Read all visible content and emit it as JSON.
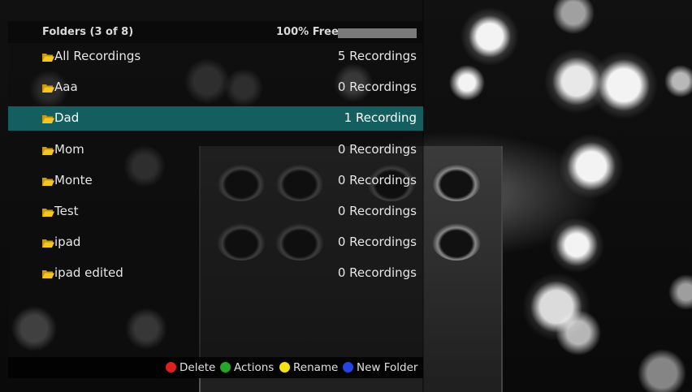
{
  "header": {
    "title": "Folders (3 of 8)",
    "free_label": "100% Free",
    "free_percent": 100
  },
  "folders": [
    {
      "name": "All Recordings",
      "count": "5 Recordings",
      "selected": false
    },
    {
      "name": "Aaa",
      "count": "0 Recordings",
      "selected": false
    },
    {
      "name": "Dad",
      "count": "1 Recording",
      "selected": true
    },
    {
      "name": "Mom",
      "count": "0 Recordings",
      "selected": false
    },
    {
      "name": "Monte",
      "count": "0 Recordings",
      "selected": false
    },
    {
      "name": "Test",
      "count": "0 Recordings",
      "selected": false
    },
    {
      "name": "ipad",
      "count": "0 Recordings",
      "selected": false
    },
    {
      "name": "ipad edited",
      "count": "0 Recordings",
      "selected": false
    }
  ],
  "footer": {
    "delete": {
      "label": "Delete",
      "color": "#d9221f"
    },
    "actions": {
      "label": "Actions",
      "color": "#25a52a"
    },
    "rename": {
      "label": "Rename",
      "color": "#f2e21a"
    },
    "new_folder": {
      "label": "New Folder",
      "color": "#2545e0"
    }
  },
  "colors": {
    "selected_row": "#145e60",
    "folder_icon": "#f3c623"
  },
  "icons": {
    "folder": "folder-icon",
    "delete_button": "red-dot-icon",
    "actions_button": "green-dot-icon",
    "rename_button": "yellow-dot-icon",
    "new_folder_button": "blue-dot-icon"
  }
}
